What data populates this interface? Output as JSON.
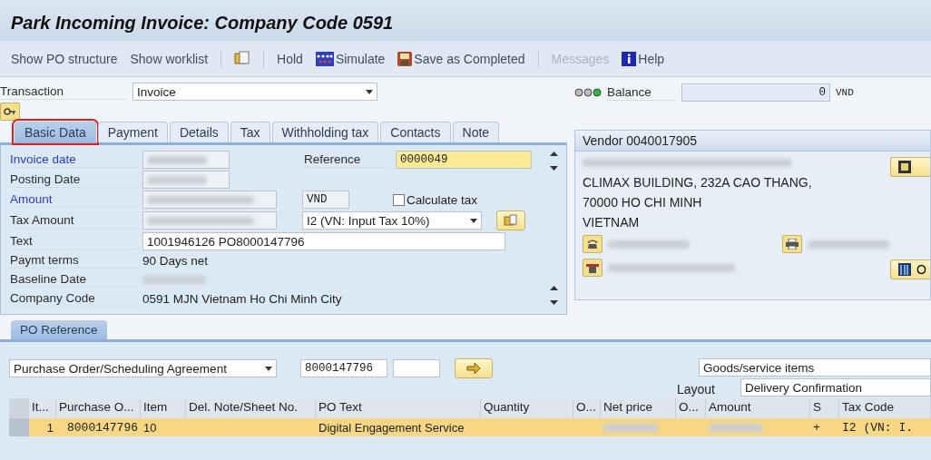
{
  "window": {
    "title": "Park Incoming Invoice: Company Code 0591"
  },
  "toolbar": [
    {
      "kind": "text",
      "label": "Show PO structure",
      "disabled": false
    },
    {
      "kind": "text",
      "label": "Show worklist",
      "disabled": false
    },
    {
      "kind": "separator"
    },
    {
      "kind": "copy"
    },
    {
      "kind": "separator"
    },
    {
      "kind": "text",
      "label": "Hold",
      "disabled": false
    },
    {
      "kind": "simulate",
      "label": "Simulate",
      "disabled": false
    },
    {
      "kind": "save",
      "label": "Save as Completed",
      "disabled": false
    },
    {
      "kind": "separator"
    },
    {
      "kind": "text",
      "label": "Messages",
      "disabled": true
    },
    {
      "kind": "help",
      "label": "Help",
      "disabled": false
    }
  ],
  "transaction": {
    "label": "Transaction",
    "value": "Invoice"
  },
  "balance": {
    "label": "Balance",
    "value": "0",
    "currency": "VND"
  },
  "tabs": [
    {
      "label": "Basic Data",
      "selected": true,
      "highlighted": true
    },
    {
      "label": "Payment",
      "selected": false,
      "highlighted": false
    },
    {
      "label": "Details",
      "selected": false,
      "highlighted": false
    },
    {
      "label": "Tax",
      "selected": false,
      "highlighted": false
    },
    {
      "label": "Withholding tax",
      "selected": false,
      "highlighted": false
    },
    {
      "label": "Contacts",
      "selected": false,
      "highlighted": false
    },
    {
      "label": "Note",
      "selected": false,
      "highlighted": false
    }
  ],
  "basic_data": {
    "invoice_date": {
      "label": "Invoice date",
      "required": true,
      "kind": "redacted"
    },
    "reference": {
      "label": "Reference",
      "value": "0000049"
    },
    "posting_date": {
      "label": "Posting Date",
      "required": false,
      "kind": "redacted"
    },
    "amount": {
      "label": "Amount",
      "required": true,
      "kind": "redacted",
      "currency": "VND"
    },
    "calculate_tax": {
      "label": "Calculate tax",
      "checked": false
    },
    "tax_amount": {
      "label": "Tax Amount",
      "required": false,
      "kind": "redacted",
      "tax_code": "I2 (VN: Input Tax 10%)"
    },
    "text": {
      "label": "Text",
      "value": "1001946126 PO8000147796"
    },
    "payment_terms": {
      "label": "Paymt terms",
      "value": "90 Days net"
    },
    "baseline_date": {
      "label": "Baseline Date",
      "kind": "redacted"
    },
    "company_code": {
      "label": "Company Code",
      "value": "0591 MJN Vietnam Ho Chi Minh City"
    }
  },
  "vendor": {
    "title": "Vendor 0040017905",
    "lines": [
      {
        "kind": "redacted"
      },
      {
        "kind": "text",
        "text": "CLIMAX BUILDING, 232A CAO THANG,"
      },
      {
        "kind": "text",
        "text": "70000 HO CHI MINH"
      },
      {
        "kind": "text",
        "text": "VIETNAM"
      }
    ],
    "more_button": "O"
  },
  "po_reference": {
    "tab": "PO Reference",
    "reference_type": "Purchase Order/Scheduling Agreement",
    "po_number": "8000147796",
    "items_select": "Goods/service items",
    "layout_label": "Layout",
    "layout": "Delivery Confirmation",
    "table": {
      "columns": [
        "It...",
        "Purchase O...",
        "Item",
        "Del. Note/Sheet No.",
        "PO Text",
        "Quantity",
        "O...",
        "Net price",
        "O...",
        "Amount",
        "S",
        "Tax Code"
      ],
      "rows": [
        {
          "selected": true,
          "cells": [
            {
              "kind": "text",
              "text": "1"
            },
            {
              "kind": "text",
              "text": "8000147796"
            },
            {
              "kind": "text",
              "text": "10"
            },
            {
              "kind": "blank"
            },
            {
              "kind": "text",
              "text": "Digital Engagement Service"
            },
            {
              "kind": "blank"
            },
            {
              "kind": "blank"
            },
            {
              "kind": "redacted"
            },
            {
              "kind": "blank"
            },
            {
              "kind": "redacted"
            },
            {
              "kind": "text",
              "text": "+"
            },
            {
              "kind": "text",
              "text": "I2 (VN: I."
            }
          ]
        }
      ]
    }
  }
}
